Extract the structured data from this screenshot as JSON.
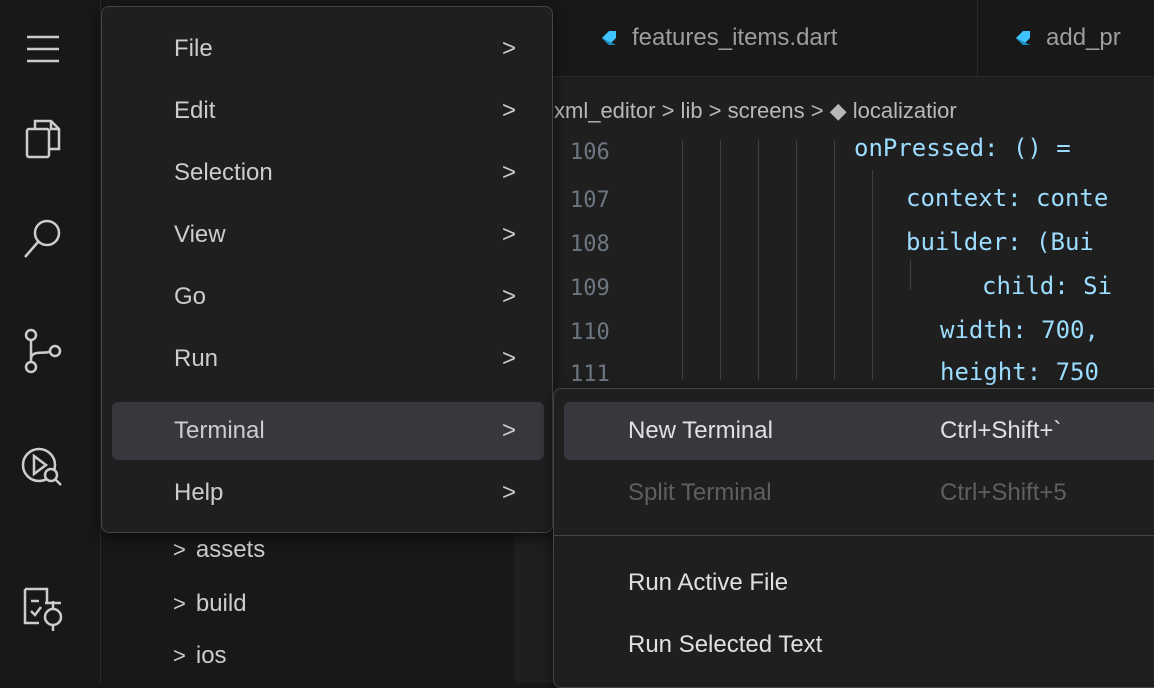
{
  "activity_bar": {
    "icons": [
      "menu-icon",
      "explorer-icon",
      "search-icon",
      "source-control-icon",
      "run-debug-icon",
      "testing-icon"
    ]
  },
  "sidebar": {
    "tree": [
      {
        "label": "assets"
      },
      {
        "label": "build"
      },
      {
        "label": "ios"
      }
    ]
  },
  "editor": {
    "tabs": [
      {
        "label": "features_items.dart"
      },
      {
        "label": "add_pr"
      }
    ],
    "breadcrumb": "xml_editor > lib > screens > ◆ localizatior",
    "lines": [
      {
        "num": "106",
        "code": "onPressed: () ="
      },
      {
        "num": "107",
        "code": "context: conte"
      },
      {
        "num": "108",
        "code": "builder: (Bui"
      },
      {
        "num": "109",
        "code": "child: Si"
      },
      {
        "num": "110",
        "code": "width: 700,"
      },
      {
        "num": "111",
        "code": "height: 750"
      }
    ]
  },
  "menu": {
    "items": [
      {
        "label": "File",
        "chevron": ">"
      },
      {
        "label": "Edit",
        "chevron": ">"
      },
      {
        "label": "Selection",
        "chevron": ">"
      },
      {
        "label": "View",
        "chevron": ">"
      },
      {
        "label": "Go",
        "chevron": ">"
      },
      {
        "label": "Run",
        "chevron": ">"
      },
      {
        "label": "Terminal",
        "chevron": ">"
      },
      {
        "label": "Help",
        "chevron": ">"
      }
    ]
  },
  "submenu": {
    "items": [
      {
        "label": "New Terminal",
        "shortcut": "Ctrl+Shift+`"
      },
      {
        "label": "Split Terminal",
        "shortcut": "Ctrl+Shift+5"
      },
      {
        "label": "Run Active File",
        "shortcut": ""
      },
      {
        "label": "Run Selected Text",
        "shortcut": ""
      }
    ]
  },
  "colors": {
    "accent_dart": "#40c4ff",
    "menu_bg": "#1f1f1f",
    "highlight": "#37373d"
  }
}
